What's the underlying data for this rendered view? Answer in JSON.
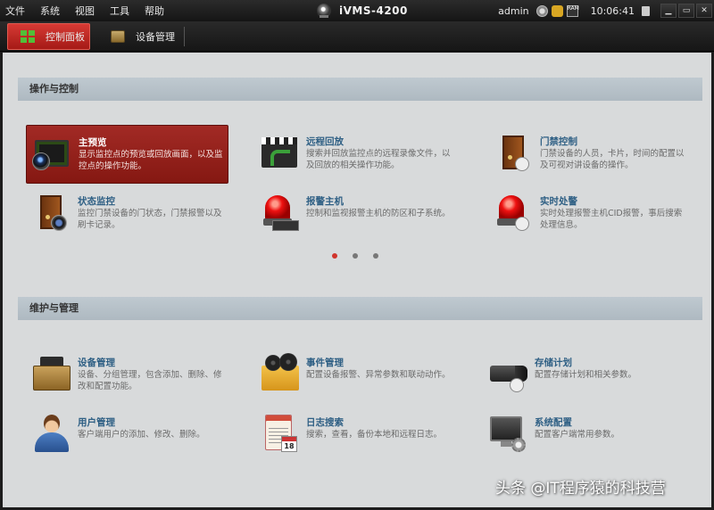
{
  "menu": [
    "文件",
    "系统",
    "视图",
    "工具",
    "帮助"
  ],
  "app": {
    "title": "iVMS-4200"
  },
  "status": {
    "user": "admin",
    "ram_label": "RAM",
    "time": "10:06:41"
  },
  "window_buttons": {
    "minimize": "▁",
    "restore": "▭",
    "close": "✕"
  },
  "tabs": [
    {
      "label": "控制面板",
      "icon": "panel-icon",
      "active": true
    },
    {
      "label": "设备管理",
      "icon": "device-icon",
      "active": false
    }
  ],
  "sections": [
    {
      "title": "操作与控制",
      "items": [
        {
          "title": "主预览",
          "desc": "显示监控点的预览或回放画面，以及监控点的操作功能。",
          "icon": "live-view-icon",
          "selected": true
        },
        {
          "title": "远程回放",
          "desc": "搜索并回放监控点的远程录像文件，以及回放的相关操作功能。",
          "icon": "playback-icon"
        },
        {
          "title": "门禁控制",
          "desc": "门禁设备的人员，卡片，时间的配置以及可视对讲设备的操作。",
          "icon": "access-control-icon"
        },
        {
          "title": "状态监控",
          "desc": "监控门禁设备的门状态，门禁报警以及刷卡记录。",
          "icon": "status-monitor-icon"
        },
        {
          "title": "报警主机",
          "desc": "控制和监视报警主机的防区和子系统。",
          "icon": "alarm-host-icon"
        },
        {
          "title": "实时处警",
          "desc": "实时处理报警主机CID报警，事后搜索处理信息。",
          "icon": "alarm-handling-icon"
        }
      ],
      "pager": {
        "count": 3,
        "active": 0
      }
    },
    {
      "title": "维护与管理",
      "items": [
        {
          "title": "设备管理",
          "desc": "设备、分组管理，包含添加、删除、修改和配置功能。",
          "icon": "device-management-icon"
        },
        {
          "title": "事件管理",
          "desc": "配置设备报警、异常参数和联动动作。",
          "icon": "event-management-icon"
        },
        {
          "title": "存储计划",
          "desc": "配置存储计划和相关参数。",
          "icon": "storage-schedule-icon"
        },
        {
          "title": "用户管理",
          "desc": "客户端用户的添加、修改、删除。",
          "icon": "user-management-icon"
        },
        {
          "title": "日志搜索",
          "desc": "搜索，查看，备份本地和远程日志。",
          "icon": "log-search-icon"
        },
        {
          "title": "系统配置",
          "desc": "配置客户端常用参数。",
          "icon": "system-config-icon"
        }
      ]
    }
  ],
  "calendar_day": "18",
  "watermark": "头条 @IT程序猿的科技营"
}
